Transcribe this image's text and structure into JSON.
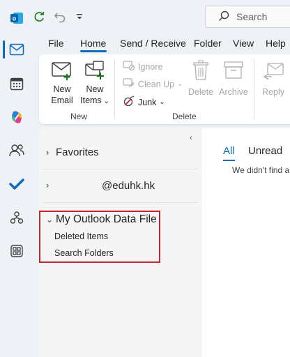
{
  "titlebar": {
    "search_placeholder": "Search"
  },
  "ribbon_tabs": [
    "File",
    "Home",
    "Send / Receive",
    "Folder",
    "View",
    "Help"
  ],
  "ribbon": {
    "new_email": [
      "New",
      "Email"
    ],
    "new_items": [
      "New",
      "Items"
    ],
    "ignore": "Ignore",
    "clean_up": "Clean Up",
    "junk": "Junk",
    "delete": "Delete",
    "archive": "Archive",
    "reply": "Reply",
    "group_new": "New",
    "group_delete": "Delete"
  },
  "folder_pane": {
    "favorites": "Favorites",
    "account": "@eduhk.hk",
    "data_file": "My Outlook Data File",
    "sub_items": [
      "Deleted Items",
      "Search Folders"
    ]
  },
  "message_list": {
    "filter_all": "All",
    "filter_unread": "Unread",
    "empty_text": "We didn't find a"
  },
  "colors": {
    "accent": "#0f6cbd",
    "highlight_border": "#c4242b"
  }
}
